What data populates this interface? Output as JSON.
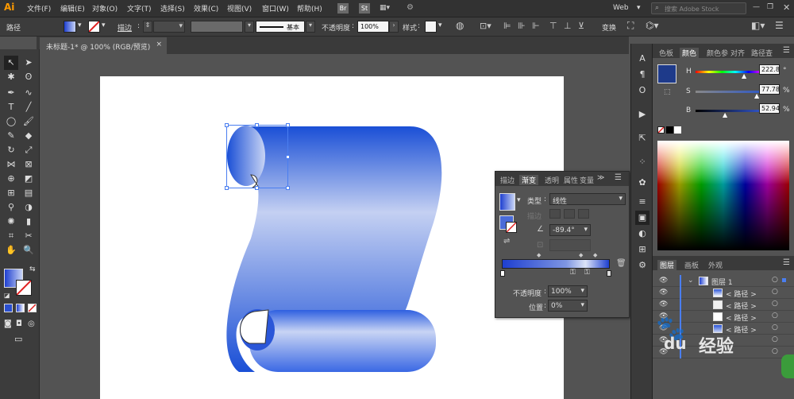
{
  "menubar": {
    "app_logo": "Ai",
    "items": [
      "文件(F)",
      "编辑(E)",
      "对象(O)",
      "文字(T)",
      "选择(S)",
      "效果(C)",
      "视图(V)",
      "窗口(W)",
      "帮助(H)"
    ],
    "bridge": "Br",
    "stock": "St",
    "workspace": "Web",
    "search_placeholder": "搜索 Adobe Stock"
  },
  "control": {
    "selection_label": "路径",
    "stroke_label": "描边",
    "brush_label": "基本",
    "opacity_label": "不透明度",
    "opacity_value": "100%",
    "style_label": "样式",
    "transform_label": "变换"
  },
  "document": {
    "tab_title": "未标题-1* @ 100% (RGB/预览)",
    "close": "×"
  },
  "color_panel": {
    "tabs": [
      "色板",
      "颜色",
      "颜色参",
      "对齐",
      "路径查"
    ],
    "active_tab": "颜色",
    "sliders": [
      {
        "label": "H",
        "value": "222.8",
        "unit": "°"
      },
      {
        "label": "S",
        "value": "77.78",
        "unit": "%"
      },
      {
        "label": "B",
        "value": "52.94",
        "unit": "%"
      }
    ],
    "current_color": "#1e3a8a"
  },
  "gradient_panel": {
    "tabs": [
      "描边",
      "渐变",
      "透明",
      "属性",
      "变量"
    ],
    "active_tab": "渐变",
    "type_label": "类型",
    "type_value": "线性",
    "stroke_label": "描边",
    "angle_value": "-89.4°",
    "opacity_label": "不透明度",
    "opacity_value": "100%",
    "position_label": "位置",
    "position_value": "0%"
  },
  "layers_panel": {
    "tabs": [
      "图层",
      "画板",
      "外观"
    ],
    "active_tab": "图层",
    "layer_name": "图层 1",
    "sublayers": [
      "< 路径 >",
      "< 路径 >",
      "< 路径 >",
      "< 路径 >"
    ]
  },
  "watermark": "经验",
  "colors": {
    "accent_blue": "#1a4fd6",
    "light_blue": "#c4d0f2",
    "ui_dark": "#323232",
    "ui_mid": "#535353"
  }
}
